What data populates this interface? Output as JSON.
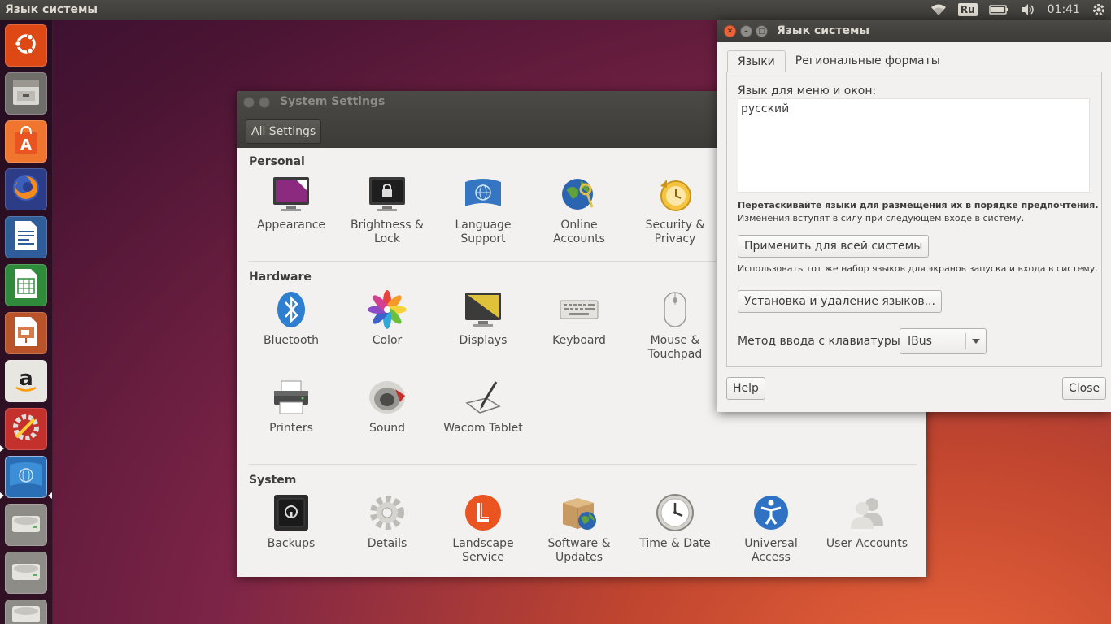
{
  "top_panel": {
    "title": "Язык системы",
    "keyboard_layout": "Ru",
    "clock": "01:41",
    "icons": [
      "wifi-icon",
      "keyboard-layout-indicator",
      "battery-icon",
      "volume-icon",
      "gear-icon"
    ]
  },
  "launcher": {
    "items": [
      {
        "name": "launcher-dash",
        "icon": "ubuntu-logo-icon"
      },
      {
        "name": "launcher-files",
        "icon": "file-cabinet-icon"
      },
      {
        "name": "launcher-software",
        "icon": "software-bag-icon"
      },
      {
        "name": "launcher-firefox",
        "icon": "firefox-icon"
      },
      {
        "name": "launcher-writer",
        "icon": "writer-document-icon"
      },
      {
        "name": "launcher-calc",
        "icon": "calc-spreadsheet-icon"
      },
      {
        "name": "launcher-impress",
        "icon": "impress-presentation-icon"
      },
      {
        "name": "launcher-amazon",
        "icon": "amazon-icon"
      },
      {
        "name": "launcher-system-settings",
        "icon": "settings-tools-icon"
      },
      {
        "name": "launcher-language-support",
        "icon": "language-flag-icon"
      },
      {
        "name": "launcher-drive-1",
        "icon": "drive-icon"
      },
      {
        "name": "launcher-drive-2",
        "icon": "drive-icon"
      },
      {
        "name": "launcher-drive-3",
        "icon": "drive-icon"
      }
    ]
  },
  "settings_window": {
    "title": "System Settings",
    "all_settings": "All Settings",
    "sections": {
      "personal": {
        "title": "Personal",
        "items": [
          {
            "l1": "Appearance",
            "l2": ""
          },
          {
            "l1": "Brightness &",
            "l2": "Lock"
          },
          {
            "l1": "Language",
            "l2": "Support"
          },
          {
            "l1": "Online",
            "l2": "Accounts"
          },
          {
            "l1": "Security &",
            "l2": "Privacy"
          }
        ]
      },
      "hardware": {
        "title": "Hardware",
        "items": [
          {
            "l1": "Bluetooth",
            "l2": ""
          },
          {
            "l1": "Color",
            "l2": ""
          },
          {
            "l1": "Displays",
            "l2": ""
          },
          {
            "l1": "Keyboard",
            "l2": ""
          },
          {
            "l1": "Mouse &",
            "l2": "Touchpad"
          },
          {
            "l1": "Printers",
            "l2": ""
          },
          {
            "l1": "Sound",
            "l2": ""
          },
          {
            "l1": "Wacom Tablet",
            "l2": ""
          }
        ]
      },
      "system": {
        "title": "System",
        "items": [
          {
            "l1": "Backups",
            "l2": ""
          },
          {
            "l1": "Details",
            "l2": ""
          },
          {
            "l1": "Landscape",
            "l2": "Service"
          },
          {
            "l1": "Software &",
            "l2": "Updates"
          },
          {
            "l1": "Time & Date",
            "l2": ""
          },
          {
            "l1": "Universal",
            "l2": "Access"
          },
          {
            "l1": "User Accounts",
            "l2": ""
          }
        ]
      }
    }
  },
  "language_window": {
    "title": "Язык системы",
    "tabs": [
      "Языки",
      "Региональные форматы"
    ],
    "menu_language_label": "Язык для меню и окон:",
    "languages": [
      "русский"
    ],
    "drag_hint": "Перетаскивайте языки для размещения их в порядке предпочтения.",
    "effect_hint": "Изменения вступят в силу при следующем входе в систему.",
    "apply_button": "Применить для всей системы",
    "apply_hint": "Использовать тот же набор языков для экранов запуска и входа в систему.",
    "install_button": "Установка и удаление языков...",
    "input_method_label": "Метод ввода с клавиатуры:",
    "input_method_value": "IBus",
    "help_button": "Help",
    "close_button": "Close"
  },
  "colors": {
    "panel": "#3c3b37",
    "window_bg": "#f2f1f0",
    "close_orange": "#e9643a"
  }
}
